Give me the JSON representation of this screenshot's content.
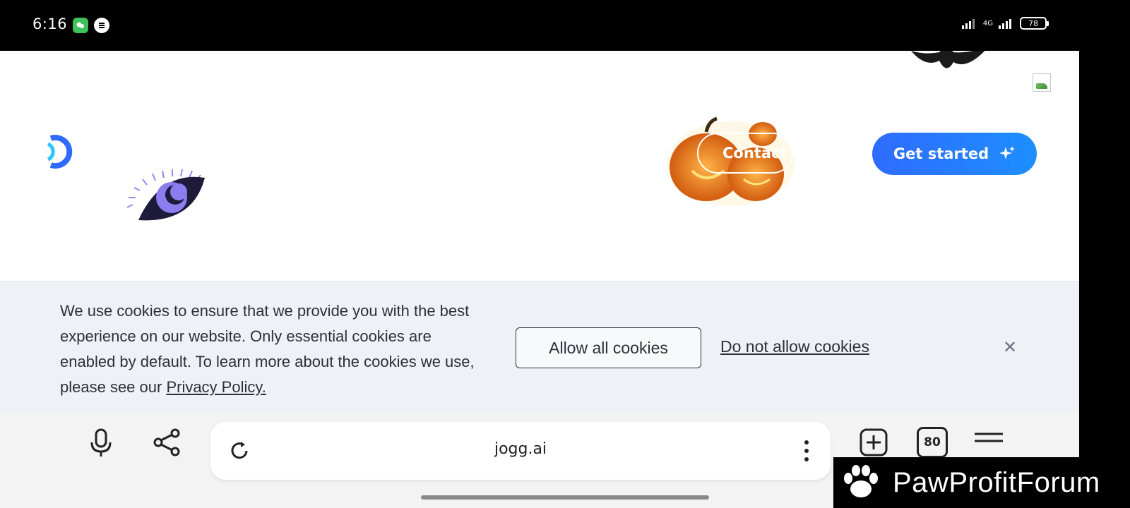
{
  "status": {
    "time": "6:16",
    "network": "4G",
    "battery": "78"
  },
  "header": {
    "contact_label": "Contact S",
    "get_started_label": "Get started"
  },
  "cookie": {
    "text": "We use cookies to ensure that we provide you with the best experience on our website. Only essential cookies are enabled by default. To learn more about the cookies we use, please see our ",
    "privacy_link": "Privacy Policy.",
    "allow_label": "Allow all cookies",
    "deny_label": "Do not allow cookies"
  },
  "browser": {
    "url": "jogg.ai",
    "tabs_count": "80"
  },
  "watermark": {
    "text": "PawProfitForum"
  },
  "colors": {
    "accent": "#2f6bff",
    "banner": "#eef2f6"
  }
}
